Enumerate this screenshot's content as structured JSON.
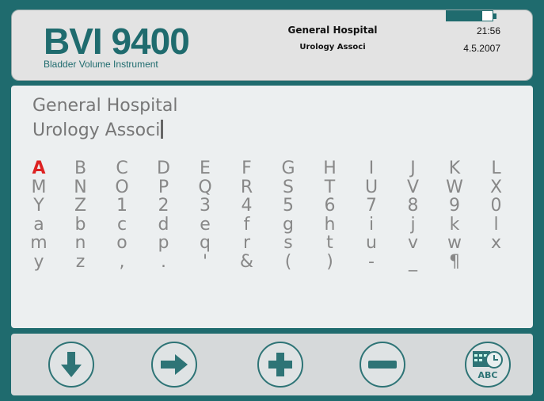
{
  "header": {
    "brand_title": "BVI 9400",
    "brand_subtitle": "Bladder Volume Instrument",
    "facility": "General Hospital",
    "department": "Urology Associ",
    "battery_level": 0.78,
    "time": "21:56",
    "date": "4.5.2007"
  },
  "entry": {
    "line1": "General Hospital",
    "line2": "Urology Associ"
  },
  "keyboard": {
    "selected": "A",
    "rows": [
      [
        "A",
        "B",
        "C",
        "D",
        "E",
        "F",
        "G",
        "H",
        "I",
        "J",
        "K",
        "L"
      ],
      [
        "M",
        "N",
        "O",
        "P",
        "Q",
        "R",
        "S",
        "T",
        "U",
        "V",
        "W",
        "X"
      ],
      [
        "Y",
        "Z",
        "1",
        "2",
        "3",
        "4",
        "5",
        "6",
        "7",
        "8",
        "9",
        "0"
      ],
      [
        "a",
        "b",
        "c",
        "d",
        "e",
        "f",
        "g",
        "h",
        "i",
        "j",
        "k",
        "l"
      ],
      [
        "m",
        "n",
        "o",
        "p",
        "q",
        "r",
        "s",
        "t",
        "u",
        "v",
        "w",
        "x"
      ],
      [
        "y",
        "z",
        ",",
        ".",
        "'",
        "&",
        "(",
        ")",
        "-",
        "_",
        "¶",
        ""
      ]
    ]
  },
  "footer": {
    "buttons": [
      {
        "name": "down-arrow-button",
        "icon": "arrow-down-icon"
      },
      {
        "name": "right-arrow-button",
        "icon": "arrow-right-icon"
      },
      {
        "name": "plus-button",
        "icon": "plus-icon"
      },
      {
        "name": "minus-button",
        "icon": "minus-icon"
      },
      {
        "name": "calendar-clock-abc-button",
        "icon": "calendar-clock-abc-icon",
        "label": "ABC"
      }
    ]
  },
  "colors": {
    "accent": "#1f6b6e",
    "selected_key": "#d22222",
    "key_text": "#888888",
    "icon_fill": "#2e7476"
  }
}
